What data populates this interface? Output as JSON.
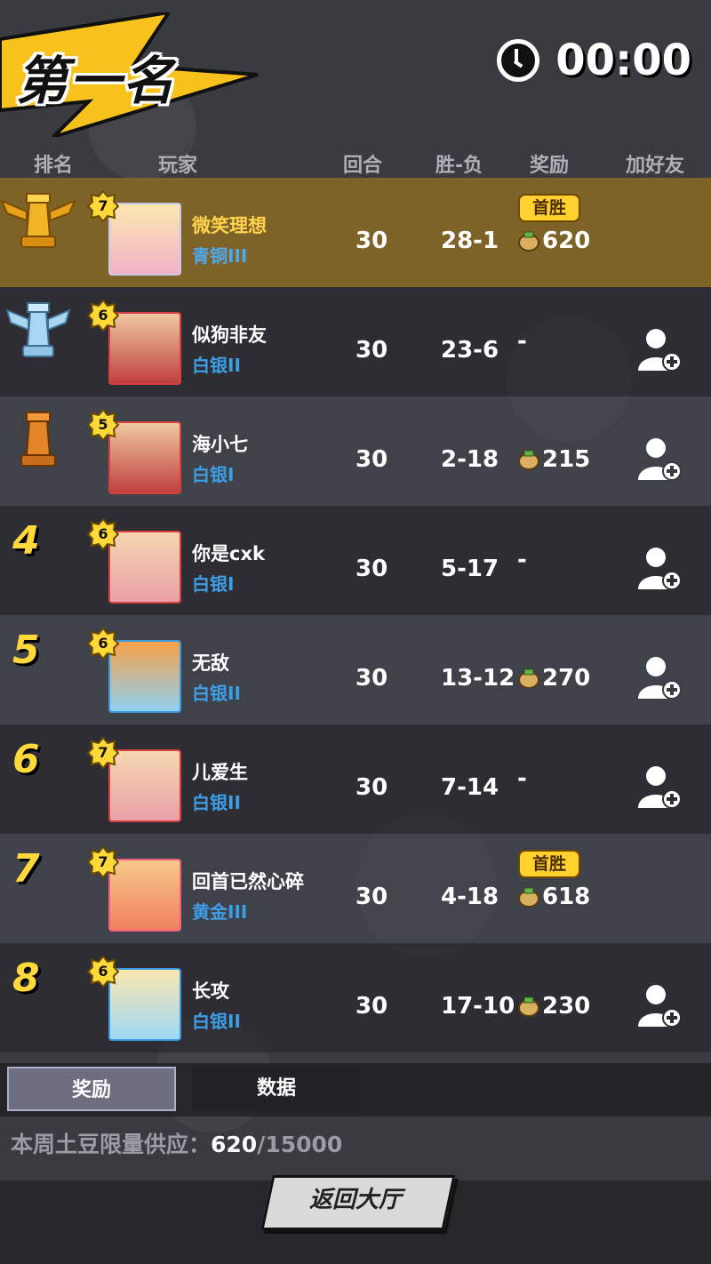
{
  "title": "第一名",
  "timer": "00:00",
  "columns": {
    "rank": "排名",
    "player": "玩家",
    "rounds": "回合",
    "wl": "胜-负",
    "reward": "奖励",
    "add_friend": "加好友"
  },
  "players": [
    {
      "rank": "1",
      "level": "7",
      "name": "微笑理想",
      "tier": "青铜III",
      "rounds": "30",
      "wl": "28-1",
      "reward": "620",
      "first_win": "首胜"
    },
    {
      "rank": "2",
      "level": "6",
      "name": "似狗非友",
      "tier": "白银II",
      "rounds": "30",
      "wl": "23-6",
      "reward": "-"
    },
    {
      "rank": "3",
      "level": "5",
      "name": "海小七",
      "tier": "白银I",
      "rounds": "30",
      "wl": "2-18",
      "reward": "215"
    },
    {
      "rank": "4",
      "level": "6",
      "name": "你是cxk",
      "tier": "白银I",
      "rounds": "30",
      "wl": "5-17",
      "reward": "-"
    },
    {
      "rank": "5",
      "level": "6",
      "name": "无敌",
      "tier": "白银II",
      "rounds": "30",
      "wl": "13-12",
      "reward": "270"
    },
    {
      "rank": "6",
      "level": "7",
      "name": "儿爱生",
      "tier": "白银II",
      "rounds": "30",
      "wl": "7-14",
      "reward": "-"
    },
    {
      "rank": "7",
      "level": "7",
      "name": "回首已然心碎",
      "tier": "黄金III",
      "rounds": "30",
      "wl": "4-18",
      "reward": "618",
      "first_win": "首胜"
    },
    {
      "rank": "8",
      "level": "6",
      "name": "长攻",
      "tier": "白银II",
      "rounds": "30",
      "wl": "17-10",
      "reward": "230"
    }
  ],
  "tabs": {
    "rewards": "奖励",
    "data": "数据"
  },
  "supply": {
    "label": "本周土豆限量供应：",
    "current": "620",
    "total": "/15000"
  },
  "back_button": "返回大厅",
  "colors": {
    "gold_row": "#846726",
    "accent_yellow": "#ffd93a",
    "tier_blue": "#3d9ee5"
  }
}
